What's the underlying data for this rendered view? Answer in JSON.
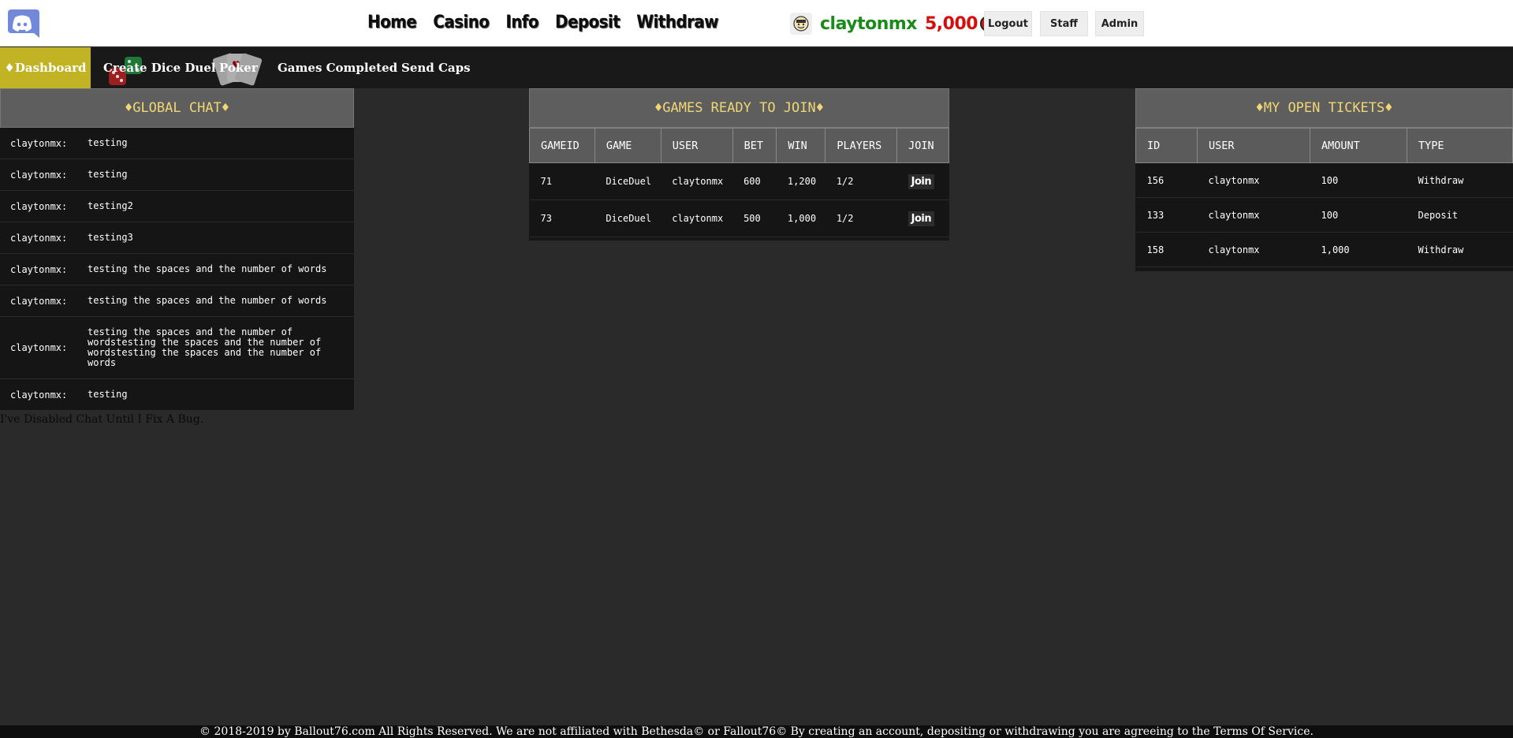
{
  "nav": {
    "links": [
      "Home",
      "Casino",
      "Info",
      "Deposit",
      "Withdraw"
    ]
  },
  "user": {
    "name": "claytonmx",
    "balance": "5,000"
  },
  "top_buttons": {
    "logout": "Logout",
    "staff": "Staff",
    "admin": "Admin"
  },
  "subnav": {
    "dashboard": "♦Dashboard",
    "create_dice_duel": "Create Dice Duel",
    "poker": "Poker",
    "games_completed": "Games Completed",
    "send_caps": "Send Caps"
  },
  "chat": {
    "title": "♦GLOBAL CHAT♦",
    "messages": [
      {
        "user": "claytonmx:",
        "text": "testing"
      },
      {
        "user": "claytonmx:",
        "text": "testing"
      },
      {
        "user": "claytonmx:",
        "text": "testing2"
      },
      {
        "user": "claytonmx:",
        "text": "testing3"
      },
      {
        "user": "claytonmx:",
        "text": "testing the spaces and the number of words"
      },
      {
        "user": "claytonmx:",
        "text": "testing the spaces and the number of words"
      },
      {
        "user": "claytonmx:",
        "text": "testing the spaces and the number of wordstesting the spaces and the number of wordstesting the spaces and the number of words"
      },
      {
        "user": "claytonmx:",
        "text": "testing"
      }
    ],
    "disabled_note": "I've Disabled Chat Until I Fix A Bug."
  },
  "games": {
    "title": "♦GAMES READY TO JOIN♦",
    "columns": [
      "GAMEID",
      "GAME",
      "USER",
      "BET",
      "WIN",
      "PLAYERS",
      "JOIN"
    ],
    "rows": [
      {
        "gameid": "71",
        "game": "DiceDuel",
        "user": "claytonmx",
        "bet": "600",
        "win": "1,200",
        "players": "1/2",
        "join": "Join"
      },
      {
        "gameid": "73",
        "game": "DiceDuel",
        "user": "claytonmx",
        "bet": "500",
        "win": "1,000",
        "players": "1/2",
        "join": "Join"
      }
    ]
  },
  "tickets": {
    "title": "♦MY OPEN TICKETS♦",
    "columns": [
      "ID",
      "USER",
      "AMOUNT",
      "TYPE"
    ],
    "rows": [
      {
        "id": "156",
        "user": "claytonmx",
        "amount": "100",
        "type": "Withdraw"
      },
      {
        "id": "133",
        "user": "claytonmx",
        "amount": "100",
        "type": "Deposit"
      },
      {
        "id": "158",
        "user": "claytonmx",
        "amount": "1,000",
        "type": "Withdraw"
      }
    ]
  },
  "footer": {
    "text": "© 2018-2019 by Ballout76.com All Rights Reserved. We are not affiliated with Bethesda© or Fallout76© By creating an account, depositing or withdrawing you are agreeing to the Terms Of Service."
  },
  "colors": {
    "accent_gold": "#c1b324",
    "title_gold": "#f0d774",
    "username_green": "#1a8a1a",
    "balance_red": "#d80c0c",
    "discord_blue": "#7289da"
  }
}
